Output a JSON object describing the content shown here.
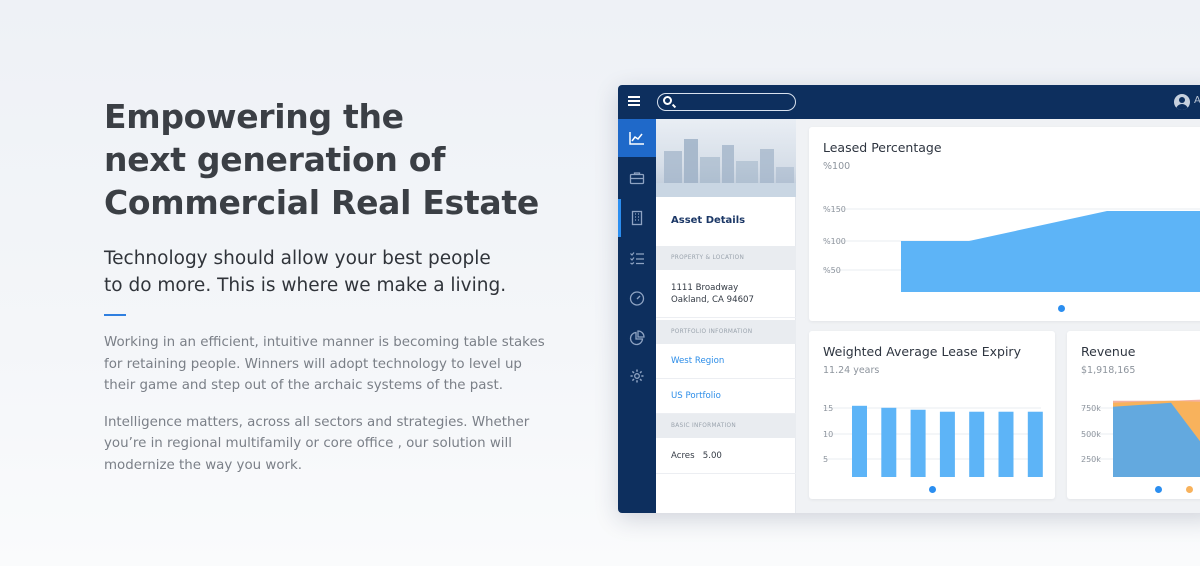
{
  "hero": {
    "heading_lines": [
      "Empowering the",
      "next generation of",
      "Commercial Real Estate"
    ],
    "subheading_lines": [
      "Technology should allow your best people",
      "to do more. This is where we make a living."
    ],
    "paragraph1_lines": [
      "Working in an efficient, intuitive manner is becoming table stakes",
      "for retaining people. Winners will adopt technology to level up",
      "their game and step out of the archaic systems of the past."
    ],
    "paragraph2_lines": [
      "Intelligence matters, across all sectors and strategies. Whether",
      "you’re in regional multifamily or core office , our solution will",
      "modernize the way you work."
    ]
  },
  "app": {
    "search_placeholder": "",
    "user_initial": "A",
    "sidenav_icons": [
      "chart-icon",
      "briefcase-icon",
      "building-icon",
      "checklist-icon",
      "gauge-icon",
      "pie-chart-icon",
      "gear-icon"
    ],
    "details": {
      "title": "Asset Details",
      "sections": {
        "property_location": "PROPERTY & LOCATION",
        "portfolio_information": "PORTFOLIO INFORMATION",
        "basic_information": "BASIC INFORMATION"
      },
      "address_lines": [
        "1111 Broadway",
        "Oakland, CA 94607"
      ],
      "region": "West Region",
      "portfolio": "US Portfolio",
      "acres_label": "Acres",
      "acres_value": "5.00"
    },
    "colors": {
      "navy": "#0d2f5e",
      "active_blue": "#1f69c9",
      "chart_blue": "#5db4f7",
      "accent_line": "#2f7fe0",
      "orange": "#f8b25c",
      "salmon": "#f4b1a0",
      "dot_blue": "#2b8ef0"
    }
  },
  "chart_data": [
    {
      "type": "area",
      "title": "Leased Percentage",
      "kpi": "%100",
      "ytick_labels": [
        "%150",
        "%100",
        "%50"
      ],
      "ylim": [
        0,
        170
      ],
      "x": [
        0,
        1,
        2,
        3
      ],
      "values": [
        100,
        100,
        150,
        150
      ]
    },
    {
      "type": "bar",
      "title": "Weighted Average Lease Expiry",
      "kpi": "11.24 years",
      "ytick_labels": [
        "15",
        "10",
        "5"
      ],
      "ylim": [
        0,
        20
      ],
      "values": [
        18,
        17.5,
        17,
        16.5,
        16.5,
        16.5,
        16.5
      ]
    },
    {
      "type": "area",
      "title": "Revenue",
      "kpi": "$1,918,165",
      "ytick_labels": [
        "750k",
        "500k",
        "250k"
      ],
      "ylim": [
        0,
        900000
      ],
      "series": [
        {
          "values": [
            760000,
            760000,
            780000
          ]
        },
        {
          "values": [
            740000,
            760000,
            740000
          ]
        },
        {
          "values": [
            700000,
            740000,
            0
          ]
        }
      ]
    }
  ]
}
